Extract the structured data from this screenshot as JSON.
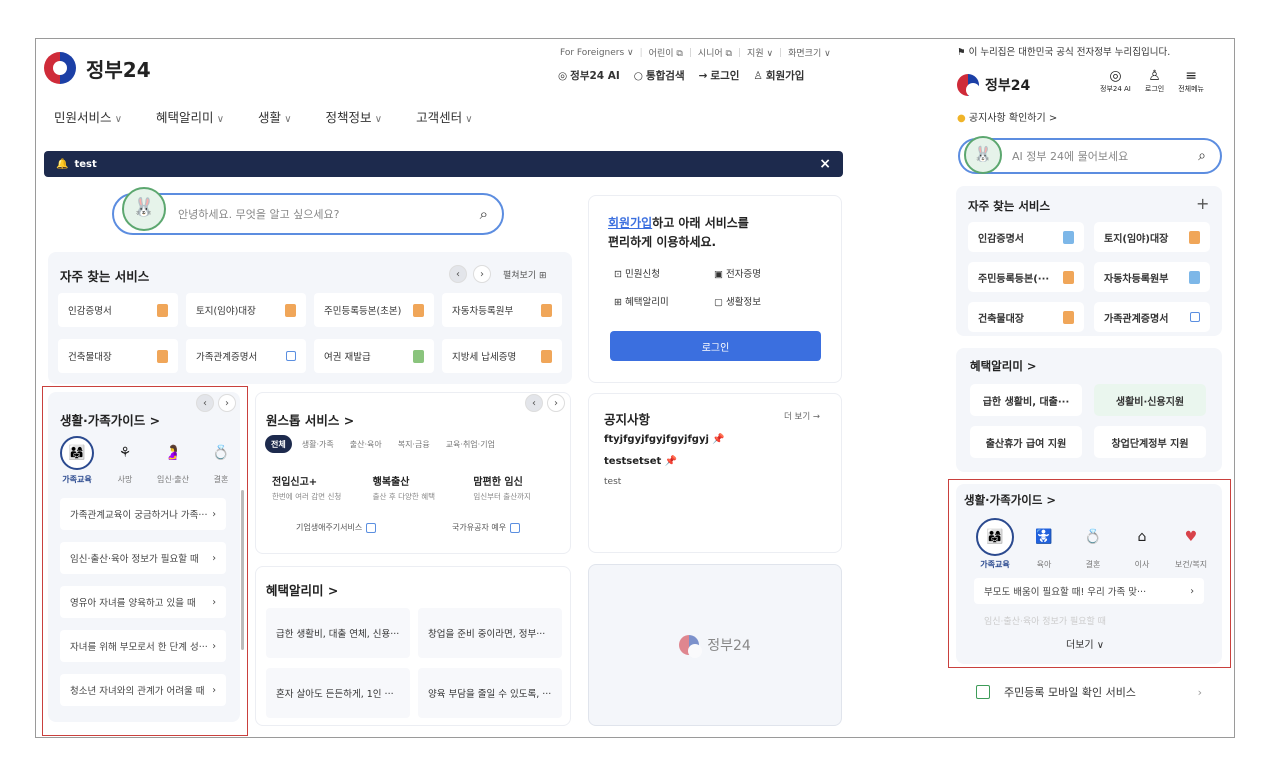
{
  "desktop": {
    "logo": {
      "text": "정부24"
    },
    "top_links": [
      "For Foreigners ∨",
      "어린이 ⧉",
      "시니어 ⧉",
      "지원 ∨",
      "화면크기 ∨"
    ],
    "utility": {
      "ai": "정부24 AI",
      "search": "통합검색",
      "login": "로그인",
      "join": "회원가입"
    },
    "gnb": [
      "민원서비스",
      "혜택알리미",
      "생활",
      "정책정보",
      "고객센터"
    ],
    "banner": {
      "text": "test",
      "close": "×"
    },
    "search": {
      "placeholder": "안녕하세요. 무엇을 알고 싶으세요?"
    },
    "frequent": {
      "title": "자주 찾는 서비스",
      "view_all": "펼쳐보기 ⊞",
      "items": [
        {
          "label": "인감증명서",
          "icon": "document-icon"
        },
        {
          "label": "토지(임야)대장",
          "icon": "document-icon"
        },
        {
          "label": "주민등록등본(초본)",
          "icon": "document-icon"
        },
        {
          "label": "자동차등록원부",
          "icon": "document-icon"
        },
        {
          "label": "건축물대장",
          "icon": "document-icon"
        },
        {
          "label": "가족관계증명서",
          "icon": "external-link-icon"
        },
        {
          "label": "여권 재발급",
          "icon": "pen-icon"
        },
        {
          "label": "지방세 납세증명",
          "icon": "document-icon"
        }
      ]
    },
    "login_card": {
      "line1_link": "회원가입",
      "line1_rest": "하고 아래 서비스를",
      "line2": "편리하게 이용하세요.",
      "features": [
        "민원신청",
        "전자증명",
        "혜택알리미",
        "생활정보"
      ],
      "button": "로그인"
    },
    "guide": {
      "title": "생활·가족가이드 >",
      "categories": [
        "가족교육",
        "사망",
        "임신·출산",
        "결혼"
      ],
      "items": [
        "가족관계교육이 궁금하거나 가족···",
        "임신·출산·육아 정보가 필요할 때",
        "영유아 자녀를 양육하고 있을 때",
        "자녀를 위해 부모로서 한 단계 성···",
        "청소년 자녀와의 관계가 어려울 때"
      ]
    },
    "onestop": {
      "title": "원스톱 서비스 >",
      "tabs": [
        "전체",
        "생활·가족",
        "출산·육아",
        "복지·금융",
        "교육·취업·기업"
      ],
      "items": [
        {
          "title": "전입신고+",
          "desc": "한번에 여러 감면 신청"
        },
        {
          "title": "행복출산",
          "desc": "출산 후 다양한 혜택"
        },
        {
          "title": "맘편한 임신",
          "desc": "임신부터 출산까지"
        }
      ],
      "links": [
        "기업생애주기서비스",
        "국가유공자 예우"
      ]
    },
    "notice": {
      "title": "공지사항",
      "more": "더 보기 →",
      "items": [
        "ftyjfgyjfgyjfgyjfgyj",
        "testsetset"
      ],
      "plain": "test"
    },
    "benefit": {
      "title": "혜택알리미 >",
      "items": [
        "급한 생활비, 대출 연체, 신용···",
        "창업을 준비 중이라면, 정부···",
        "혼자 살아도 든든하게, 1인 ···",
        "양육 부담을 줄일 수 있도록, ···"
      ]
    },
    "promo_logo": "정부24"
  },
  "mobile": {
    "gov_notice": "이 누리집은 대한민국 공식 전자정부 누리집입니다.",
    "logo": "정부24",
    "header_icons": [
      {
        "label": "정부24 AI",
        "icon": "ai-icon"
      },
      {
        "label": "로그인",
        "icon": "user-icon"
      },
      {
        "label": "전체메뉴",
        "icon": "menu-icon"
      }
    ],
    "notice_link": "공지사항 확인하기 >",
    "ai_placeholder": "AI 정부 24에 물어보세요",
    "frequent": {
      "title": "자주 찾는 서비스",
      "add": "+",
      "items": [
        {
          "label": "인감증명서",
          "icon": "document-icon"
        },
        {
          "label": "토지(임야)대장",
          "icon": "document-icon"
        },
        {
          "label": "주민등록등본(···",
          "icon": "document-icon"
        },
        {
          "label": "자동차등록원부",
          "icon": "document-icon"
        },
        {
          "label": "건축물대장",
          "icon": "document-icon"
        },
        {
          "label": "가족관계증명서",
          "icon": "external-link-icon"
        }
      ]
    },
    "benefit": {
      "title": "혜택알리미 >",
      "items": [
        "급한 생활비, 대출···",
        "생활비·신용지원",
        "출산휴가 급여 지원",
        "창업단계정부 지원"
      ]
    },
    "guide": {
      "title": "생활·가족가이드 >",
      "categories": [
        "가족교육",
        "육아",
        "결혼",
        "이사",
        "보건/복지"
      ],
      "item1": "부모도 배움이 필요할 때! 우리 가족 맞···",
      "item2": "임신·출산·육아 정보가 필요할 때",
      "more": "더보기 ∨"
    },
    "mobile_id": "주민등록 모바일 확인 서비스"
  },
  "colors": {
    "navy": "#1d2a4d",
    "blue": "#3b6fdf",
    "red_highlight": "#c9403d",
    "gov_red": "#cf2b39",
    "gov_blue": "#1b3fa6"
  }
}
